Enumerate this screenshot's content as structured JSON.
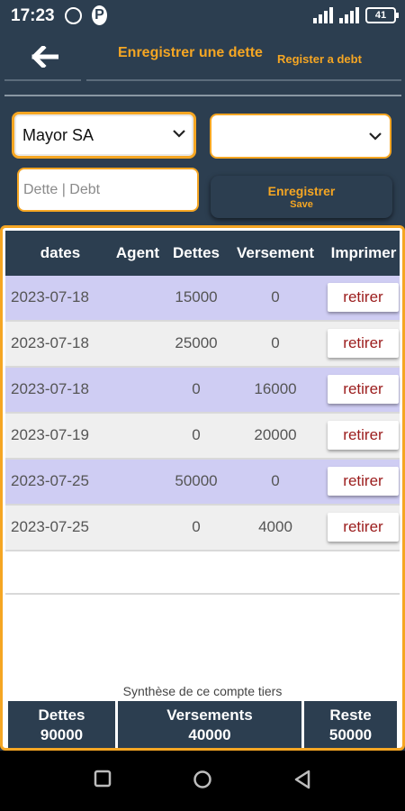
{
  "status": {
    "time": "17:23",
    "battery": "41"
  },
  "header": {
    "title_fr": "Enregistrer une dette",
    "title_en": "Register a debt"
  },
  "form": {
    "tiers_selected": "Mayor SA",
    "second_selected": "",
    "debt_placeholder": "Dette | Debt",
    "save_label": "Enregistrer",
    "save_label_en": "Save"
  },
  "table": {
    "headers": [
      "dates",
      "Agent",
      "Dettes",
      "Versement",
      "Imprimer"
    ],
    "rows": [
      {
        "date": "2023-07-18",
        "agent": "",
        "dettes": "15000",
        "versement": "0",
        "action": "retirer"
      },
      {
        "date": "2023-07-18",
        "agent": "",
        "dettes": "25000",
        "versement": "0",
        "action": "retirer"
      },
      {
        "date": "2023-07-18",
        "agent": "",
        "dettes": "0",
        "versement": "16000",
        "action": "retirer"
      },
      {
        "date": "2023-07-19",
        "agent": "",
        "dettes": "0",
        "versement": "20000",
        "action": "retirer"
      },
      {
        "date": "2023-07-25",
        "agent": "",
        "dettes": "50000",
        "versement": "0",
        "action": "retirer"
      },
      {
        "date": "2023-07-25",
        "agent": "",
        "dettes": "0",
        "versement": "4000",
        "action": "retirer"
      }
    ]
  },
  "summary": {
    "title": "Synthèse de ce compte tiers",
    "dettes_label": "Dettes",
    "dettes_value": "90000",
    "versements_label": "Versements",
    "versements_value": "40000",
    "reste_label": "Reste",
    "reste_value": "50000"
  },
  "colors": {
    "primary": "#2c3e50",
    "accent": "#f5a623",
    "row_alt": "#cfcdf3",
    "row_plain": "#efefef",
    "action_text": "#9b1c1c"
  }
}
